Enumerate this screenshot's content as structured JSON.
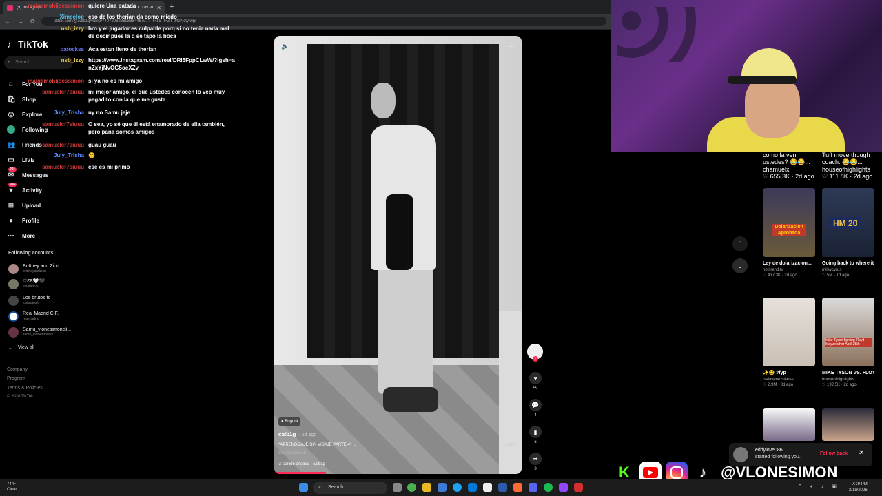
{
  "browser": {
    "tab_title": "(9) Instagram",
    "tab_title2": "ACTIO...DN VI",
    "url": "tiktok.com/@calb1g/video/74072982889888446797?_r=1&_t=ZT-942Nctyfwpi"
  },
  "tiktok": {
    "logo_text": "TikTok",
    "search_placeholder": "Search",
    "nav": [
      {
        "label": "For You",
        "icon": "home-icon"
      },
      {
        "label": "Shop",
        "icon": "shop-icon"
      },
      {
        "label": "Explore",
        "icon": "compass-icon"
      },
      {
        "label": "Following",
        "icon": "following-icon"
      },
      {
        "label": "Friends",
        "icon": "friends-icon"
      },
      {
        "label": "LIVE",
        "icon": "live-icon"
      },
      {
        "label": "Messages",
        "icon": "messages-icon",
        "badge": "99+"
      },
      {
        "label": "Activity",
        "icon": "activity-icon",
        "badge": "99+"
      },
      {
        "label": "Upload",
        "icon": "upload-icon"
      },
      {
        "label": "Profile",
        "icon": "profile-icon"
      },
      {
        "label": "More",
        "icon": "more-icon"
      }
    ],
    "following_header": "Following accounts",
    "accounts": [
      {
        "name": "Brittney and Zion",
        "handle": "brittneyandzion"
      },
      {
        "name": "♡ƐƐ🤍🖤",
        "handle": "elsamo697"
      },
      {
        "name": "Los brutos fc",
        "handle": "losbrutosfc"
      },
      {
        "name": "Real Madrid C.F.",
        "handle": "realmadrid"
      },
      {
        "name": "Samu_vlonesimoncli...",
        "handle": "samu_vlonesimoncl"
      }
    ],
    "view_all": "View all",
    "footer": [
      "Company",
      "Program",
      "Terms & Policies",
      "© 2026 TikTok"
    ]
  },
  "chat": [
    {
      "user": "malgamohijoessimon",
      "color": "#d63b3b",
      "text": "quiere Una patada"
    },
    {
      "user": "Ximeclop",
      "color": "#58c1e8",
      "text": "eso de los therian da como miedo"
    },
    {
      "user": "nsb_izzy",
      "color": "#e3c84a",
      "text": "bro y el jugador es culpable porq si no tenia nada mal de decir pues la q se tapo la boca"
    },
    {
      "user": "patockss",
      "color": "#6b78f0",
      "text": "Aca estan lleno de therian"
    },
    {
      "user": "nsb_izzy",
      "color": "#e3c84a",
      "text": "https://www.instagram.com/reel/DRI5FppCLwW/?igsh=anZxYjNvOG5ocXZy"
    },
    {
      "user": "malgamohijoessimon",
      "color": "#d63b3b",
      "text": "si ya no es mi amigo"
    },
    {
      "user": "samuelcr7siuuu",
      "color": "#c83a3a",
      "text": "mi mejor amigo, el que ustedes conocen lo veo muy pegadito con la que me gusta"
    },
    {
      "user": "July_Trisha",
      "color": "#5b8bff",
      "text": "uy no Samu jeje"
    },
    {
      "user": "samuelcr7siuuu",
      "color": "#c83a3a",
      "text": "O sea, yo sé que él está enamorado de ella también, pero pana somos amigos"
    },
    {
      "user": "samuelcr7siuuu",
      "color": "#c83a3a",
      "text": "guau guau"
    },
    {
      "user": "July_Trisha",
      "color": "#5b8bff",
      "text": "😊"
    },
    {
      "user": "samuelcr7siuuu",
      "color": "#c83a3a",
      "text": "ese es mi primo"
    }
  ],
  "video": {
    "location": "Bogotá",
    "author": "calb1g",
    "date": "· 2d ago",
    "caption": "*APRENDIZAJE SIN VISAJE PARTE 4* ...",
    "more": "more",
    "see_translation": "See translation",
    "sound": "♫ sonido original - calb1g",
    "progress": 0.21
  },
  "actions": {
    "likes": "59",
    "comments": "4",
    "saves": "6",
    "shares": "3"
  },
  "grid": [
    {
      "title": "como la ven ustedes? 😂😂...",
      "author": "chamuelx",
      "stats": "♡ 655.3K · 2d ago"
    },
    {
      "title": "Tuff move though coach. 😂😂...",
      "author": "houseofhighlights",
      "stats": "♡ 111.8K · 2d ago"
    },
    {
      "title": "Ley de dolarizacion...",
      "author": "notitrend.tv",
      "stats": "♡ 437.3K · 2d ago",
      "thumb_text": "Dolarizacion Aprobada"
    },
    {
      "title": "Going back to where it all...",
      "author": "mileycyrus",
      "stats": "♡ 5M · 1d ago",
      "thumb_text": "HM 20"
    },
    {
      "title": "✨😂 #fyp",
      "author": "isalavenezolanaa",
      "stats": "♡ 2.9M · 3d ago"
    },
    {
      "title": "MIKE TYSON VS. FLOYD...",
      "author": "houseofhighlights",
      "stats": "♡ 192.5K · 2d ago",
      "thumb_text": "Mike Tyson fighting Floyd Mayweather April 25th"
    }
  ],
  "notification": {
    "user": "eddylove086",
    "text": "started following you.",
    "action": "Follow back"
  },
  "social": {
    "handle": "@VLONESIMON",
    "kick": "K"
  },
  "taskbar": {
    "weather_temp": "74°F",
    "weather_desc": "Clear",
    "search": "Search",
    "time": "7:19 PM",
    "date": "2/18/2026"
  }
}
